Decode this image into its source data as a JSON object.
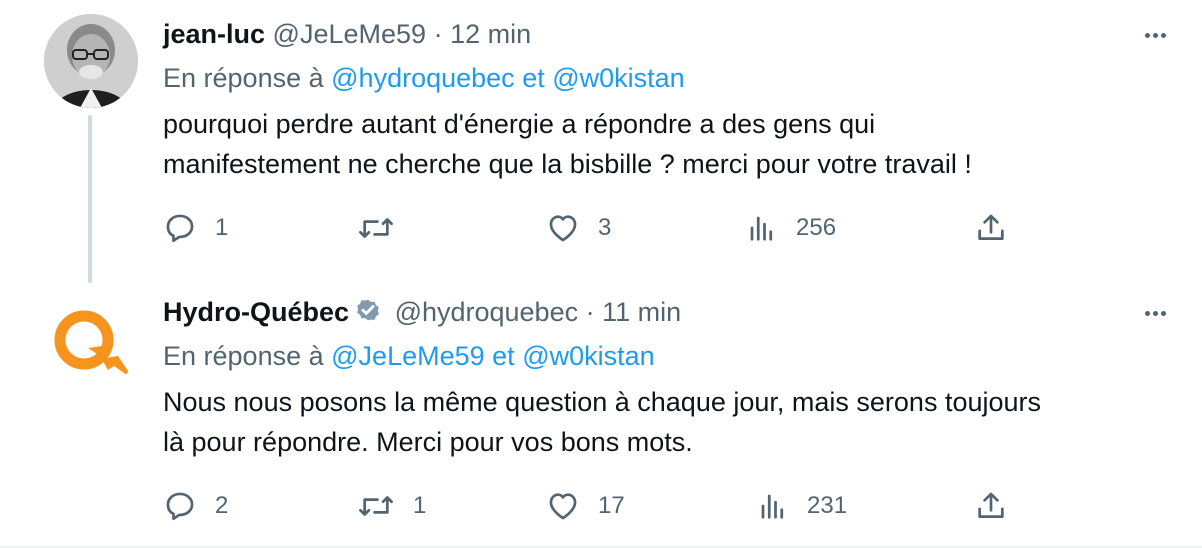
{
  "tweets": [
    {
      "author_name": "jean-luc",
      "handle": "@JeLeMe59",
      "separator": "·",
      "time": "12 min",
      "reply_prefix": "En réponse à",
      "reply_mentions": [
        "@hydroquebec",
        "@w0kistan"
      ],
      "reply_joiner": "et",
      "text_lines": [
        "pourquoi perdre autant d'énergie a répondre a des gens qui",
        "manifestement ne cherche que la bisbille ? merci  pour votre travail !"
      ],
      "verified": false,
      "stats": {
        "replies": "1",
        "retweets": "",
        "likes": "3",
        "views": "256"
      }
    },
    {
      "author_name": "Hydro-Québec",
      "handle": "@hydroquebec",
      "separator": "·",
      "time": "11 min",
      "reply_prefix": "En réponse à",
      "reply_mentions": [
        "@JeLeMe59",
        "@w0kistan"
      ],
      "reply_joiner": "et",
      "text_lines": [
        "Nous nous posons la même question à chaque jour, mais serons toujours",
        "là pour répondre. Merci pour vos bons mots."
      ],
      "verified": true,
      "stats": {
        "replies": "2",
        "retweets": "1",
        "likes": "17",
        "views": "231"
      }
    }
  ],
  "icons": {
    "reply": "reply-icon",
    "retweet": "retweet-icon",
    "like": "heart-icon",
    "views": "views-icon",
    "share": "share-icon",
    "more": "more-icon",
    "verified": "verified-badge-icon"
  },
  "colors": {
    "text": "#0f1419",
    "secondary": "#536471",
    "mention": "#1d9bf0",
    "hydro_orange": "#f7941d",
    "thread_line": "#cfd9de"
  }
}
